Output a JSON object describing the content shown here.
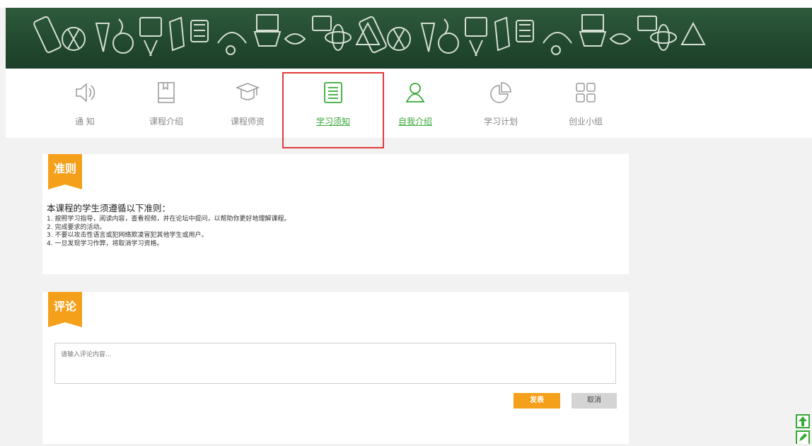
{
  "nav": {
    "items": [
      {
        "label": "通 知",
        "icon": "speaker-icon"
      },
      {
        "label": "课程介绍",
        "icon": "book-icon"
      },
      {
        "label": "课程师资",
        "icon": "graduation-cap-icon"
      },
      {
        "label": "学习须知",
        "icon": "list-document-icon"
      },
      {
        "label": "自我介绍",
        "icon": "user-icon"
      },
      {
        "label": "学习计划",
        "icon": "pie-chart-icon"
      },
      {
        "label": "创业小组",
        "icon": "grid-icon"
      }
    ]
  },
  "rules": {
    "heading": "准则",
    "intro": "本课程的学生须遵循以下准则：",
    "items": [
      "1. 按照学习指导，阅读内容，查看视频，并在论坛中提问，以帮助你更好地理解课程。",
      "2. 完成要求的活动。",
      "3. 不要以攻击性语言或犯网络欺凌冒犯其他学生或用户。",
      "4. 一旦发现学习作弊，将取消学习资格。"
    ]
  },
  "comments": {
    "heading": "评论",
    "placeholder": "请输入评论内容...",
    "submit_label": "发表",
    "cancel_label": "取消"
  },
  "colors": {
    "accent": "#f5a01a",
    "active_nav": "#39a939",
    "highlight_box": "#e03a3a",
    "banner": "#244b31"
  },
  "side_tools": [
    "arrow-up-icon",
    "edit-icon"
  ]
}
